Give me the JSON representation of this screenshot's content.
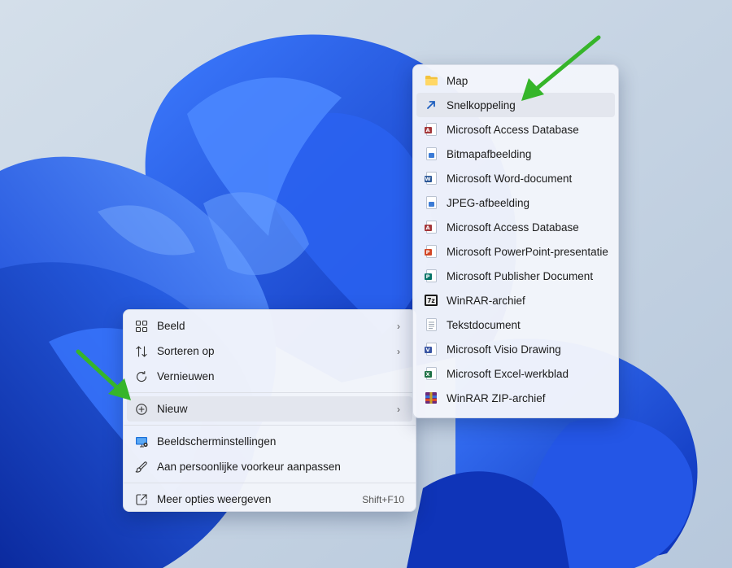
{
  "context_menu": {
    "items": [
      {
        "icon": "grid-view-icon",
        "label": "Beeld",
        "submenu": true
      },
      {
        "icon": "sort-icon",
        "label": "Sorteren op",
        "submenu": true
      },
      {
        "icon": "refresh-icon",
        "label": "Vernieuwen"
      },
      {
        "icon": "add-circle-icon",
        "label": "Nieuw",
        "submenu": true
      },
      {
        "icon": "display-settings-icon",
        "label": "Beeldscherminstellingen"
      },
      {
        "icon": "personalize-brush-icon",
        "label": "Aan persoonlijke voorkeur aanpassen"
      },
      {
        "icon": "more-options-icon",
        "label": "Meer opties weergeven",
        "shortcut": "Shift+F10"
      }
    ]
  },
  "new_submenu": {
    "items": [
      {
        "icon": "folder-icon",
        "label": "Map"
      },
      {
        "icon": "shortcut-arrow-icon",
        "label": "Snelkoppeling"
      },
      {
        "icon": "access-database-icon",
        "label": "Microsoft Access Database"
      },
      {
        "icon": "bitmap-image-icon",
        "label": "Bitmapafbeelding"
      },
      {
        "icon": "word-document-icon",
        "label": "Microsoft Word-document"
      },
      {
        "icon": "jpeg-image-icon",
        "label": "JPEG-afbeelding"
      },
      {
        "icon": "access-database-icon",
        "label": "Microsoft Access Database"
      },
      {
        "icon": "powerpoint-presentation-icon",
        "label": "Microsoft PowerPoint-presentatie"
      },
      {
        "icon": "publisher-document-icon",
        "label": "Microsoft Publisher Document"
      },
      {
        "icon": "winrar-archive-icon",
        "label": "WinRAR-archief"
      },
      {
        "icon": "text-document-icon",
        "label": "Tekstdocument"
      },
      {
        "icon": "visio-drawing-icon",
        "label": "Microsoft Visio Drawing"
      },
      {
        "icon": "excel-worksheet-icon",
        "label": "Microsoft Excel-werkblad"
      },
      {
        "icon": "winrar-zip-archive-icon",
        "label": "WinRAR ZIP-archief"
      }
    ]
  },
  "colors": {
    "wallpaper_background": "#c9d6e4",
    "bloom_blue": "#1a4fe0",
    "annotation_arrow": "#36b52a",
    "access": "#a4373a",
    "word": "#2b5797",
    "powerpoint": "#d24726",
    "publisher": "#077568",
    "visio": "#3955a3",
    "excel": "#1e7145"
  }
}
